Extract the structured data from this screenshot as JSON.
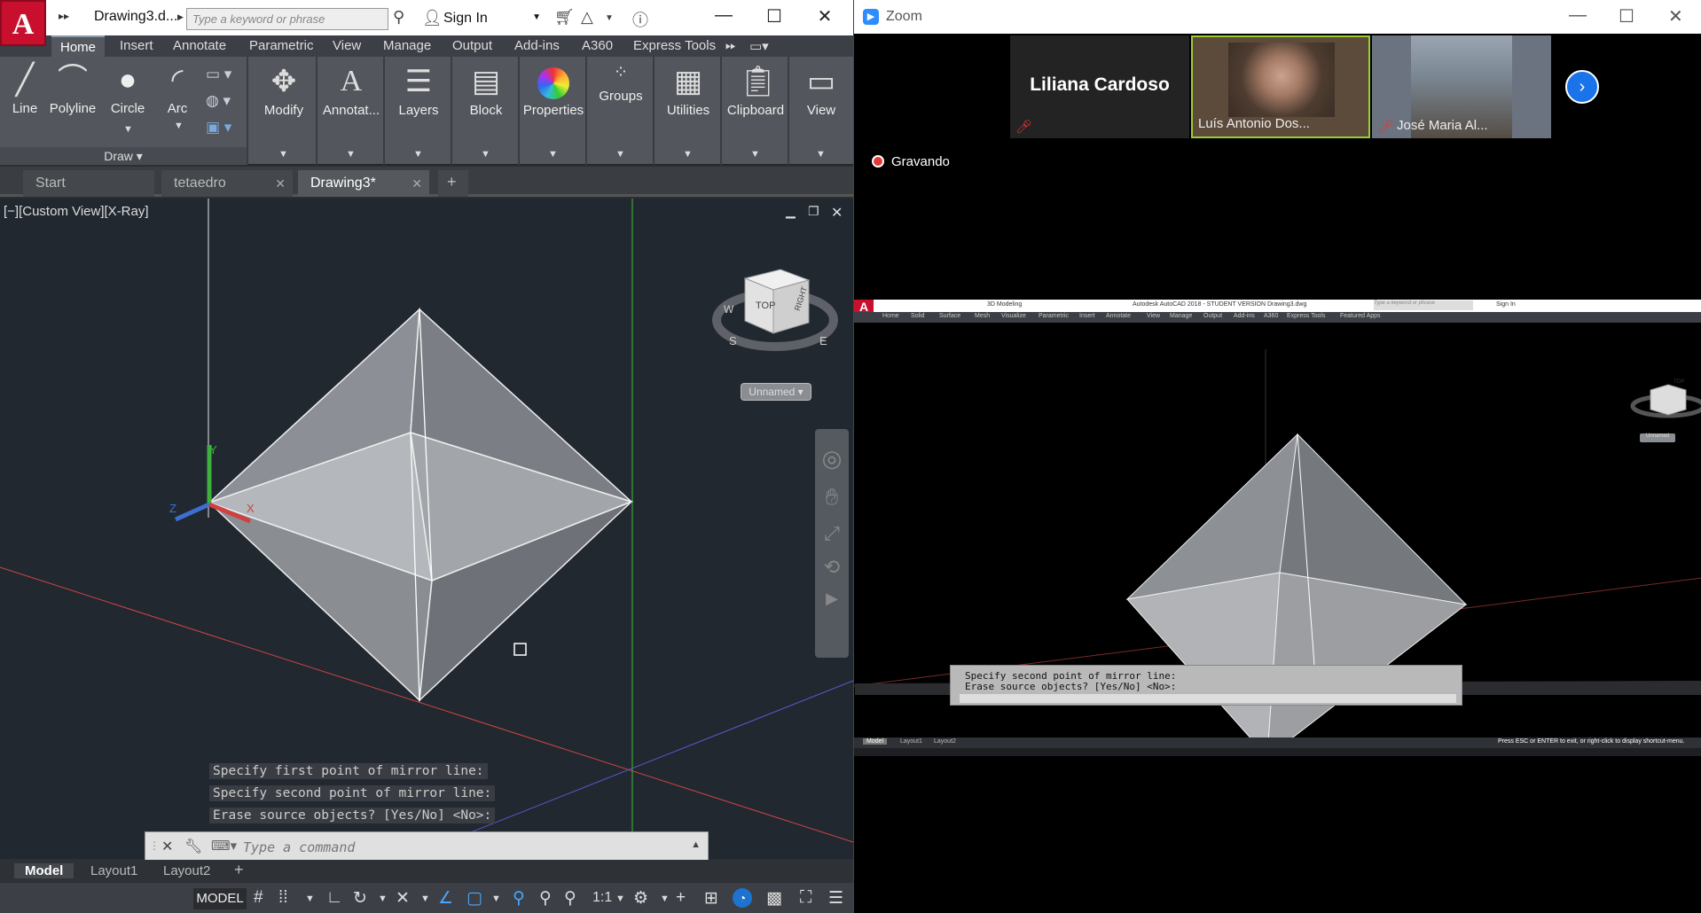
{
  "autocad": {
    "logo": "A",
    "title": "Drawing3.d...",
    "search_placeholder": "Type a keyword or phrase",
    "signin": "Sign In",
    "ribbon_tabs": [
      "Home",
      "Insert",
      "Annotate",
      "Parametric",
      "View",
      "Manage",
      "Output",
      "Add-ins",
      "A360",
      "Express Tools"
    ],
    "draw_tools": [
      "Line",
      "Polyline",
      "Circle",
      "Arc"
    ],
    "draw_panel": "Draw",
    "panels": [
      "Modify",
      "Annotat...",
      "Layers",
      "Block",
      "Properties",
      "Groups",
      "Utilities",
      "Clipboard",
      "View"
    ],
    "doc_tabs": [
      "Start",
      "tetaedro",
      "Drawing3*"
    ],
    "viewport_label": "[−][Custom View][X-Ray]",
    "viewcube": {
      "top": "TOP",
      "right": "RIGHT",
      "s": "S",
      "e": "E",
      "w": "W"
    },
    "view_name": "Unnamed",
    "history": [
      "Specify first point of mirror line:",
      "Specify second point of mirror line:",
      "Erase source objects? [Yes/No] <No>:"
    ],
    "command_placeholder": "Type a command",
    "layout_tabs": [
      "Model",
      "Layout1",
      "Layout2"
    ],
    "model_status": "MODEL",
    "scale": "1:1",
    "axes": {
      "x": "X",
      "y": "Y",
      "z": "Z"
    }
  },
  "zoom": {
    "title": "Zoom",
    "participants": [
      {
        "name": "Liliana Cardoso"
      },
      {
        "name": "Luís Antonio Dos..."
      },
      {
        "name": "José Maria Al..."
      }
    ],
    "recording": "Gravando",
    "shared": {
      "title": "Autodesk AutoCAD 2018 - STUDENT VERSION     Drawing3.dwg",
      "workspace": "3D Modeling",
      "search": "Type a keyword or phrase",
      "signin": "Sign In",
      "tabs": [
        "Home",
        "Solid",
        "Surface",
        "Mesh",
        "Visualize",
        "Parametric",
        "Insert",
        "Annotate",
        "View",
        "Manage",
        "Output",
        "Add-ins",
        "A360",
        "Express Tools",
        "Featured Apps"
      ],
      "view_name": "Unnamed",
      "cube_top": "TOP",
      "history": [
        "Specify second point of mirror line:",
        "Erase source objects? [Yes/No] <No>:"
      ],
      "layout_tabs": [
        "Model",
        "Layout1",
        "Layout2"
      ],
      "status_msg": "Press ESC or ENTER to exit, or right-click to display shortcut-menu."
    }
  }
}
